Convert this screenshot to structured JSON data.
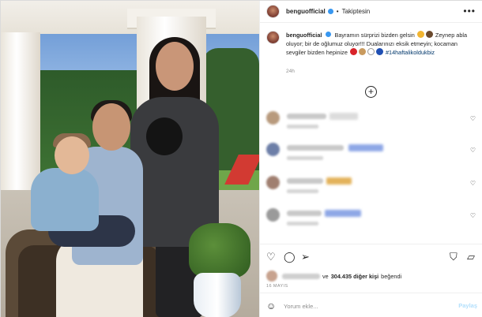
{
  "post": {
    "username": "benguofficial",
    "follow_label": "Takiptesin",
    "more_icon": "more-horizontal-icon"
  },
  "caption": {
    "username": "benguofficial",
    "line1": "Bayramın sürprizi bizden gelsin",
    "line2": "Zeynep abla oluyor; bir de oğlumuz oluyor!!! Dualarınızı eksik etmeyin; kocaman sevgiler bizden hepinize",
    "hashtag": "#14haftalikoldukbiz",
    "time": "24h"
  },
  "likes": {
    "text": "ve",
    "count": "304.435 diğer kişi",
    "suffix": "beğendi"
  },
  "date": "16 MAYIS",
  "add_comment": {
    "placeholder": "Yorum ekle...",
    "share_label": "Paylaş"
  },
  "colors": {
    "link": "#00376b",
    "verified": "#3897f0",
    "share_disabled": "#b2dffc"
  }
}
